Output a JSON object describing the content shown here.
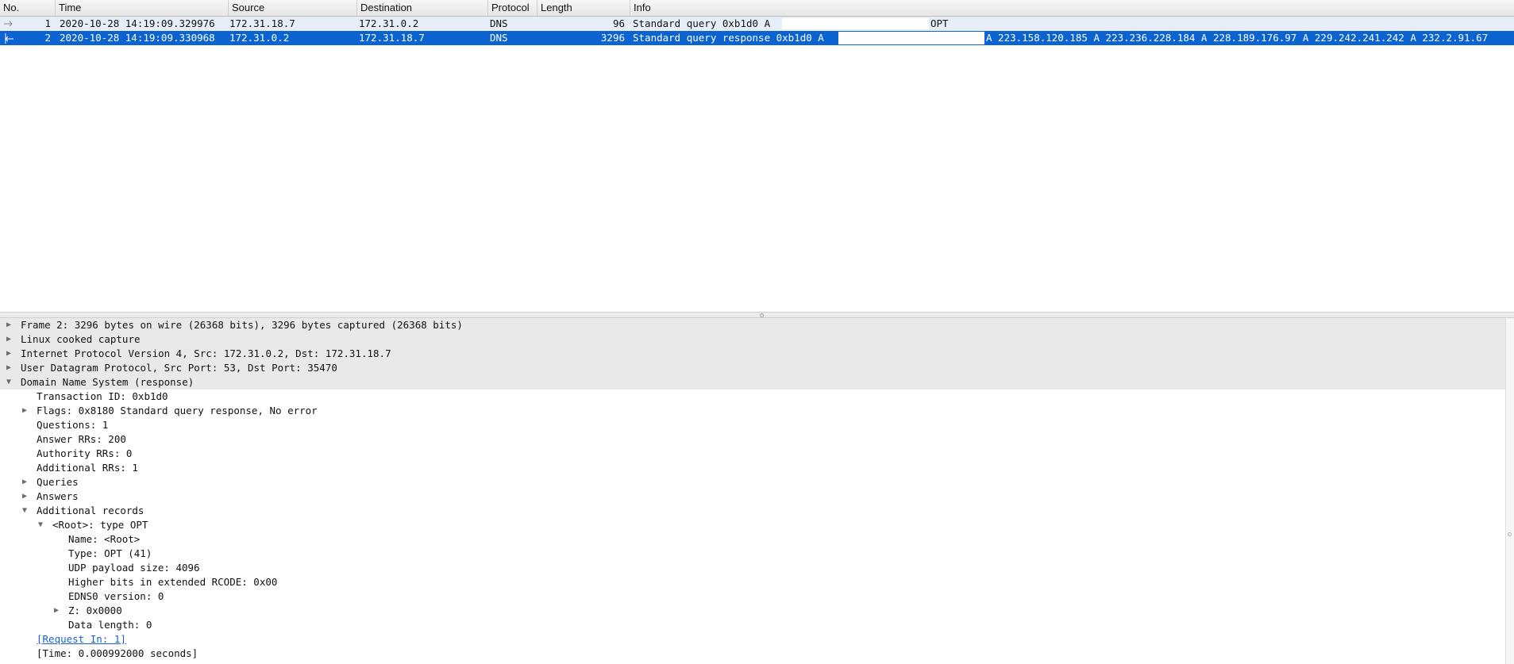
{
  "columns": {
    "no": "No.",
    "time": "Time",
    "source": "Source",
    "destination": "Destination",
    "protocol": "Protocol",
    "length": "Length",
    "info": "Info"
  },
  "packets": [
    {
      "no": "1",
      "time": "2020-10-28 14:19:09.329976",
      "source": "172.31.18.7",
      "destination": "172.31.0.2",
      "protocol": "DNS",
      "length": "96",
      "info_prefix": "Standard query 0xb1d0 A",
      "info_suffix": "OPT",
      "icon": "request-arrow-icon",
      "selected": false
    },
    {
      "no": "2",
      "time": "2020-10-28 14:19:09.330968",
      "source": "172.31.0.2",
      "destination": "172.31.18.7",
      "protocol": "DNS",
      "length": "3296",
      "info_prefix": "Standard query response 0xb1d0 A",
      "info_suffix": "A 223.158.120.185 A 223.236.228.184 A 228.189.176.97 A 229.242.241.242 A 232.2.91.67",
      "icon": "response-arrow-icon",
      "selected": true
    }
  ],
  "details": {
    "frame": "Frame 2: 3296 bytes on wire (26368 bits), 3296 bytes captured (26368 bits)",
    "linux_cooked": "Linux cooked capture",
    "ip": "Internet Protocol Version 4, Src: 172.31.0.2, Dst: 172.31.18.7",
    "udp": "User Datagram Protocol, Src Port: 53, Dst Port: 35470",
    "dns": "Domain Name System (response)",
    "transaction_id": "Transaction ID: 0xb1d0",
    "flags": "Flags: 0x8180 Standard query response, No error",
    "questions": "Questions: 1",
    "answer_rrs": "Answer RRs: 200",
    "authority_rrs": "Authority RRs: 0",
    "additional_rrs": "Additional RRs: 1",
    "queries": "Queries",
    "answers": "Answers",
    "additional_records": "Additional records",
    "root_opt": "<Root>: type OPT",
    "name": "Name: <Root>",
    "type": "Type: OPT (41)",
    "udp_payload": "UDP payload size: 4096",
    "higher_bits": "Higher bits in extended RCODE: 0x00",
    "edns0": "EDNS0 version: 0",
    "z": "Z: 0x0000",
    "data_length": "Data length: 0",
    "request_in": "[Request In: 1]",
    "time": "[Time: 0.000992000 seconds]"
  },
  "colors": {
    "selected_row": "#0a63d0",
    "unselected_row": "#e7eef9",
    "link": "#1a5fd0"
  }
}
